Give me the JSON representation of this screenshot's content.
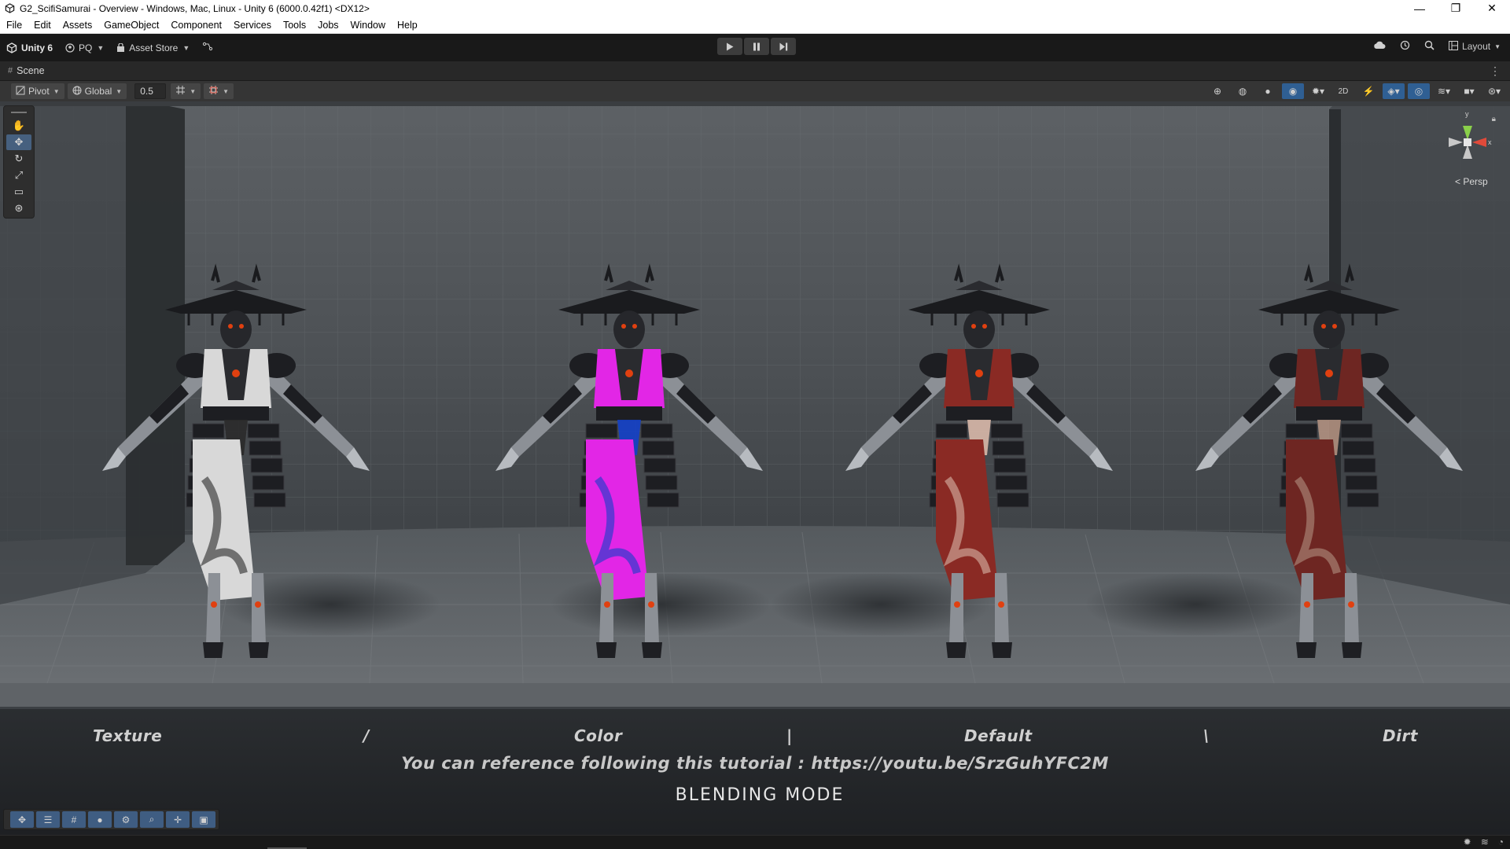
{
  "window": {
    "title": "G2_ScifiSamurai - Overview - Windows, Mac, Linux - Unity 6 (6000.0.42f1) <DX12>",
    "controls": [
      "—",
      "❐",
      "✕"
    ]
  },
  "menu": [
    "File",
    "Edit",
    "Assets",
    "GameObject",
    "Component",
    "Services",
    "Tools",
    "Jobs",
    "Window",
    "Help"
  ],
  "toolbar": {
    "account_label": "Unity 6",
    "pq_label": "PQ",
    "asset_store_label": "Asset Store",
    "layout_label": "Layout"
  },
  "scene_tab": {
    "label": "Scene"
  },
  "scene_toolbar": {
    "pivot_label": "Pivot",
    "global_label": "Global",
    "grid_snap_value": "0.5"
  },
  "gizmo": {
    "persp_label": "< Persp",
    "y": "y",
    "x": "x"
  },
  "scene": {
    "sign_labels": [
      "Texture",
      "/",
      "Color",
      "|",
      "Default",
      "\\",
      "Dirt"
    ],
    "tutorial_text": "You can reference following this tutorial : https://youtu.be/SrzGuhYFC2M",
    "blending_mode_text": "BLENDING MODE",
    "characters": [
      {
        "variant": "Texture",
        "robe_color": "#d8d8d8",
        "robe_accent": "#2a2a2a",
        "armor_color": "#1d1e22",
        "highlight": "#e04010"
      },
      {
        "variant": "Color",
        "robe_color": "#e226e6",
        "robe_accent": "#1340c8",
        "armor_color": "#1d1e22",
        "highlight": "#e04010"
      },
      {
        "variant": "Default",
        "robe_color": "#8a2a24",
        "robe_accent": "#d8b8a8",
        "armor_color": "#1d1e22",
        "highlight": "#e04010"
      },
      {
        "variant": "Dirt",
        "robe_color": "#6e2622",
        "robe_accent": "#b09080",
        "armor_color": "#1d1e22",
        "highlight": "#e04010"
      }
    ]
  },
  "colors": {
    "editor_bg": "#191919",
    "scene_bg": "#4c5054",
    "accent_blue": "#2f5f93"
  }
}
